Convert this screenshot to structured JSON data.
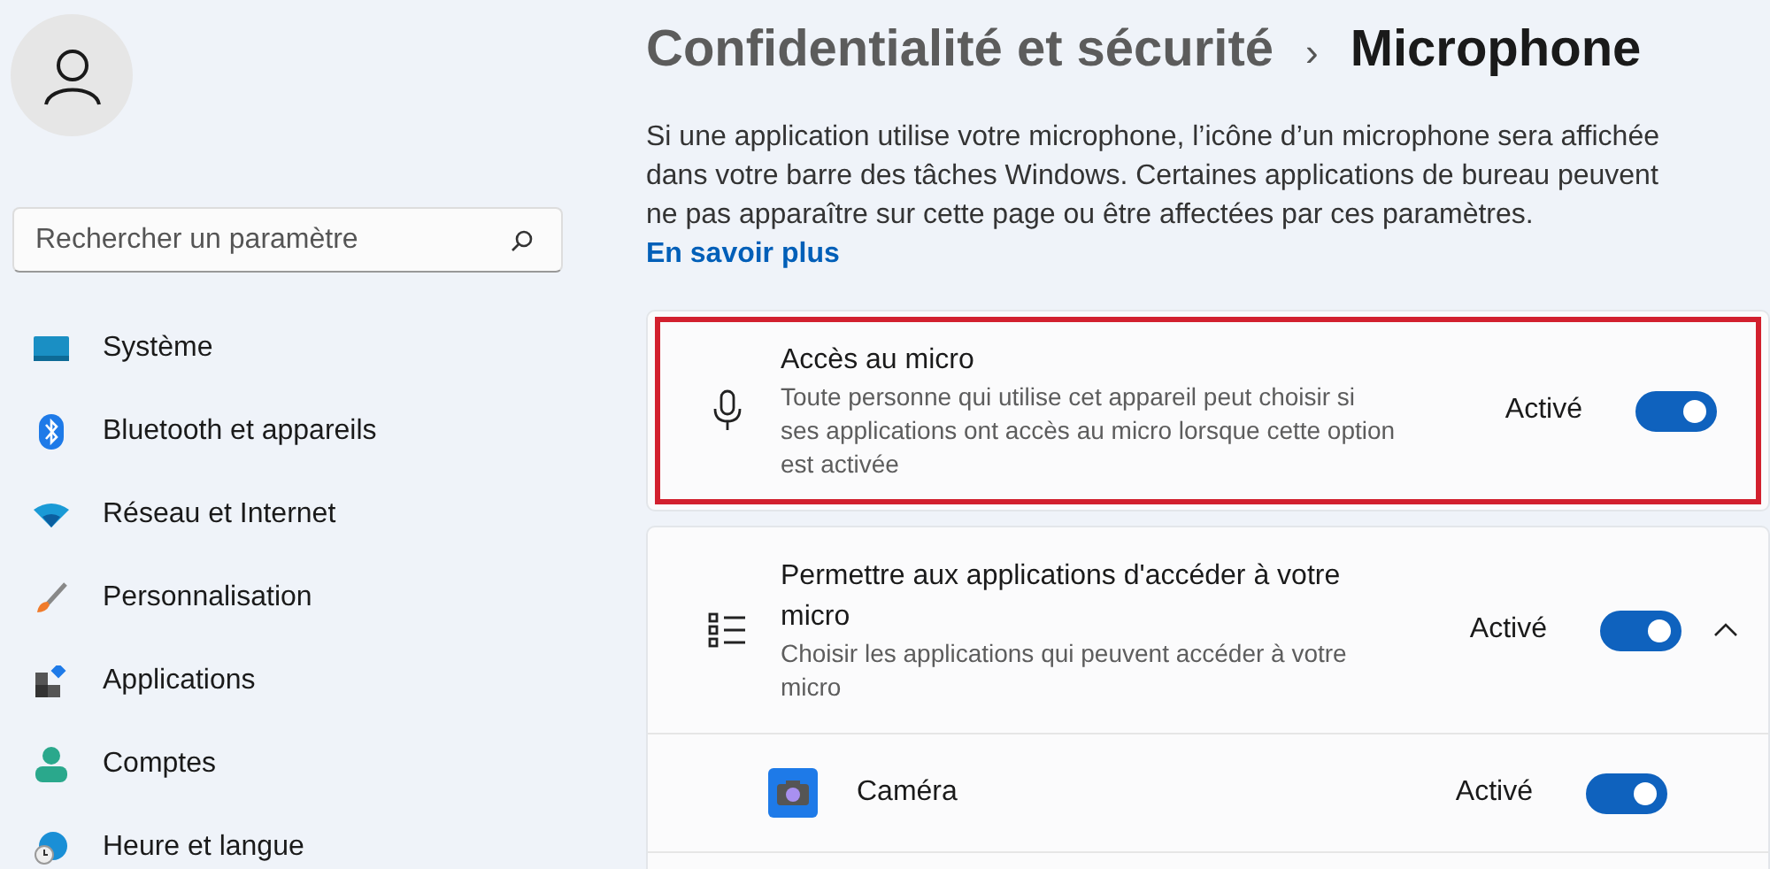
{
  "sidebar": {
    "search": {
      "placeholder": "Rechercher un paramètre"
    },
    "items": [
      {
        "label": "Système",
        "kind": "system"
      },
      {
        "label": "Bluetooth et appareils",
        "kind": "bluetooth"
      },
      {
        "label": "Réseau et Internet",
        "kind": "network"
      },
      {
        "label": "Personnalisation",
        "kind": "brush"
      },
      {
        "label": "Applications",
        "kind": "apps"
      },
      {
        "label": "Comptes",
        "kind": "accounts"
      },
      {
        "label": "Heure et langue",
        "kind": "time"
      }
    ]
  },
  "breadcrumb": {
    "parent": "Confidentialité et sécurité",
    "separator": "›",
    "current": "Microphone"
  },
  "description": {
    "text": "Si une application utilise votre microphone, l’icône d’un microphone sera affichée dans votre barre des tâches Windows. Certaines applications de bureau peuvent ne pas apparaître sur cette page ou être affectées par ces paramètres.",
    "link": "En savoir plus"
  },
  "settings": [
    {
      "kind": "mic",
      "title": "Accès au micro",
      "subtitle": "Toute personne qui utilise cet appareil peut choisir si ses applications ont accès au micro lorsque cette option est activée",
      "state": "Activé",
      "on": true,
      "highlighted": true
    },
    {
      "kind": "list",
      "title": "Permettre aux applications d'accéder à votre micro",
      "subtitle": "Choisir les applications qui peuvent accéder à votre micro",
      "state": "Activé",
      "on": true,
      "expanded": true,
      "apps": [
        {
          "name": "Caméra",
          "state": "Activé",
          "on": true
        }
      ]
    }
  ]
}
